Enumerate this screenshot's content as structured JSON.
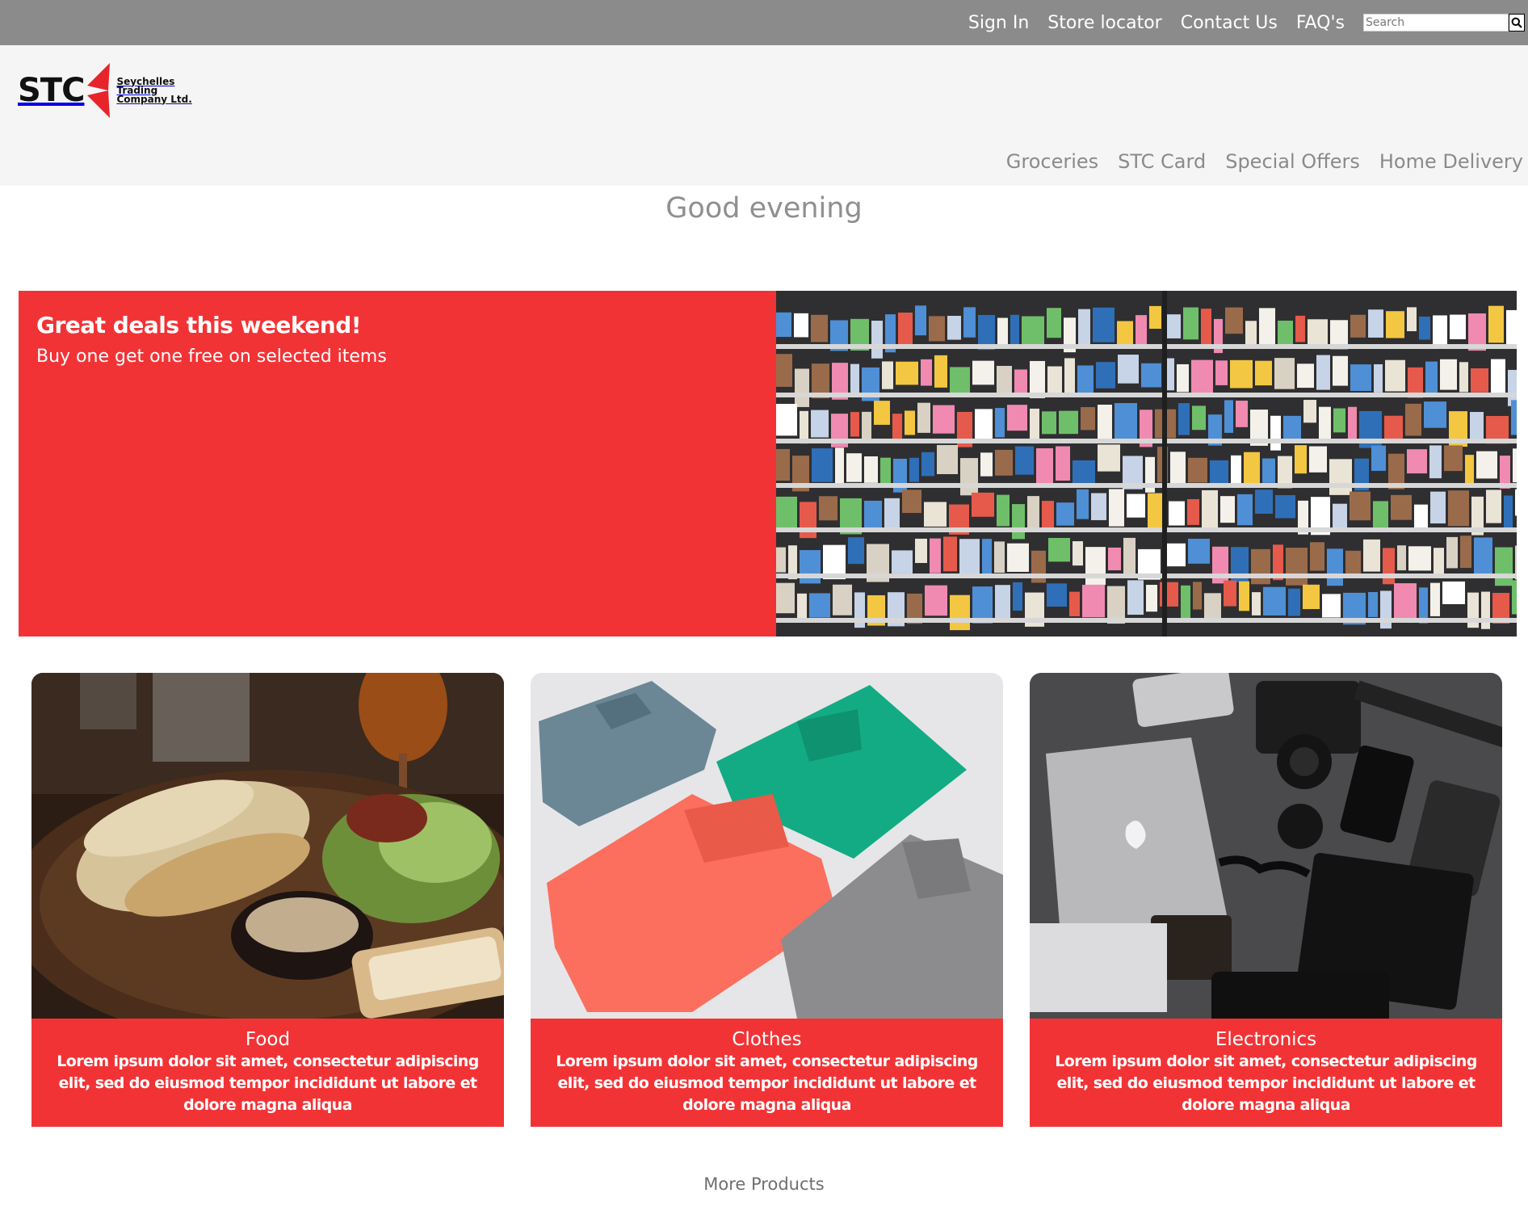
{
  "topbar": {
    "links": [
      "Sign In",
      "Store locator",
      "Contact Us",
      "FAQ's"
    ],
    "search": {
      "placeholder": "Search",
      "value": ""
    },
    "search_icon": "magnifier-icon"
  },
  "header": {
    "logo": {
      "mark": "STC",
      "company_lines": [
        "Seychelles",
        "Trading",
        "Company Ltd."
      ]
    },
    "nav": [
      "Groceries",
      "STC Card",
      "Special Offers",
      "Home Delivery"
    ]
  },
  "greeting": "Good evening",
  "promo": {
    "title": "Great deals this weekend!",
    "subtitle": "Buy one get one free on selected items"
  },
  "cards": [
    {
      "title": "Food",
      "description": "Lorem ipsum dolor sit amet, consectetur adipiscing elit, sed do eiusmod tempor incididunt ut labore et dolore magna aliqua"
    },
    {
      "title": "Clothes",
      "description": "Lorem ipsum dolor sit amet, consectetur adipiscing elit, sed do eiusmod tempor incididunt ut labore et dolore magna aliqua"
    },
    {
      "title": "Electronics",
      "description": "Lorem ipsum dolor sit amet, consectetur adipiscing elit, sed do eiusmod tempor incididunt ut labore et dolore magna aliqua"
    }
  ],
  "more_products": "More Products",
  "colors": {
    "topbar": "#8c8b8c",
    "header": "#f5f5f5",
    "accent_red": "#f23336",
    "nav_text": "#8a8a8a",
    "logo_red": "#e8242b"
  }
}
